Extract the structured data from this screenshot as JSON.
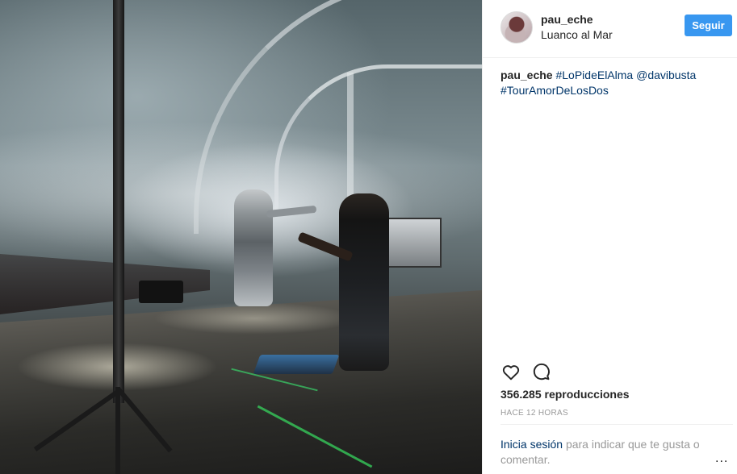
{
  "post": {
    "username": "pau_eche",
    "location": "Luanco al Mar",
    "follow_label": "Seguir",
    "caption": {
      "user": "pau_eche",
      "tag1": "#LoPideElAlma",
      "mention": "@davibusta",
      "tag2": "#TourAmorDeLosDos"
    },
    "views": "356.285 reproducciones",
    "time": "HACE 12 HORAS",
    "login_link": "Inicia sesión",
    "login_rest": "para indicar que te gusta o comentar.",
    "more_label": "..."
  },
  "icons": {
    "like": "heart-icon",
    "comment": "comment-icon",
    "more": "more-options-icon"
  },
  "colors": {
    "accent": "#3897f0",
    "link": "#003569",
    "muted": "#999999"
  }
}
